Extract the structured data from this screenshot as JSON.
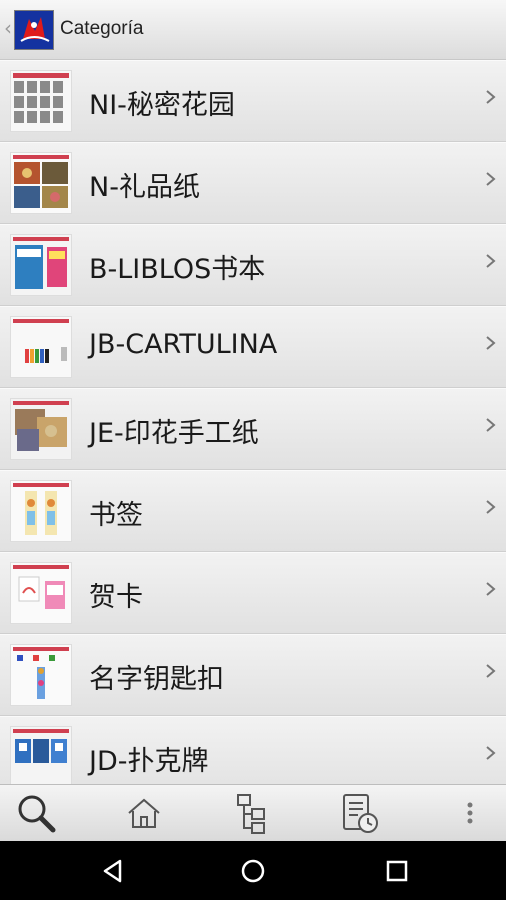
{
  "header": {
    "back_glyph": "‹",
    "title": "Categoría",
    "logo_icon": "app-logo-icon"
  },
  "categories": [
    {
      "label": "NI-秘密花园",
      "thumb_icon": "secret-garden-thumbnail"
    },
    {
      "label": "N-礼品纸",
      "thumb_icon": "gift-paper-thumbnail"
    },
    {
      "label": "B-LIBLOS书本",
      "thumb_icon": "books-thumbnail"
    },
    {
      "label": "JB-CARTULINA",
      "thumb_icon": "cardboard-thumbnail"
    },
    {
      "label": "JE-印花手工纸",
      "thumb_icon": "printed-craft-paper-thumbnail"
    },
    {
      "label": "书签",
      "thumb_icon": "bookmark-thumbnail"
    },
    {
      "label": "贺卡",
      "thumb_icon": "greeting-card-thumbnail"
    },
    {
      "label": "名字钥匙扣",
      "thumb_icon": "name-keychain-thumbnail"
    },
    {
      "label": "JD-扑克牌",
      "thumb_icon": "playing-cards-thumbnail"
    }
  ],
  "toolbar": {
    "items": [
      "search-icon",
      "home-icon",
      "category-tree-icon",
      "history-icon",
      "overflow-menu-icon"
    ]
  },
  "system_nav": {
    "items": [
      "back-triangle-icon",
      "home-circle-icon",
      "recents-square-icon"
    ]
  }
}
